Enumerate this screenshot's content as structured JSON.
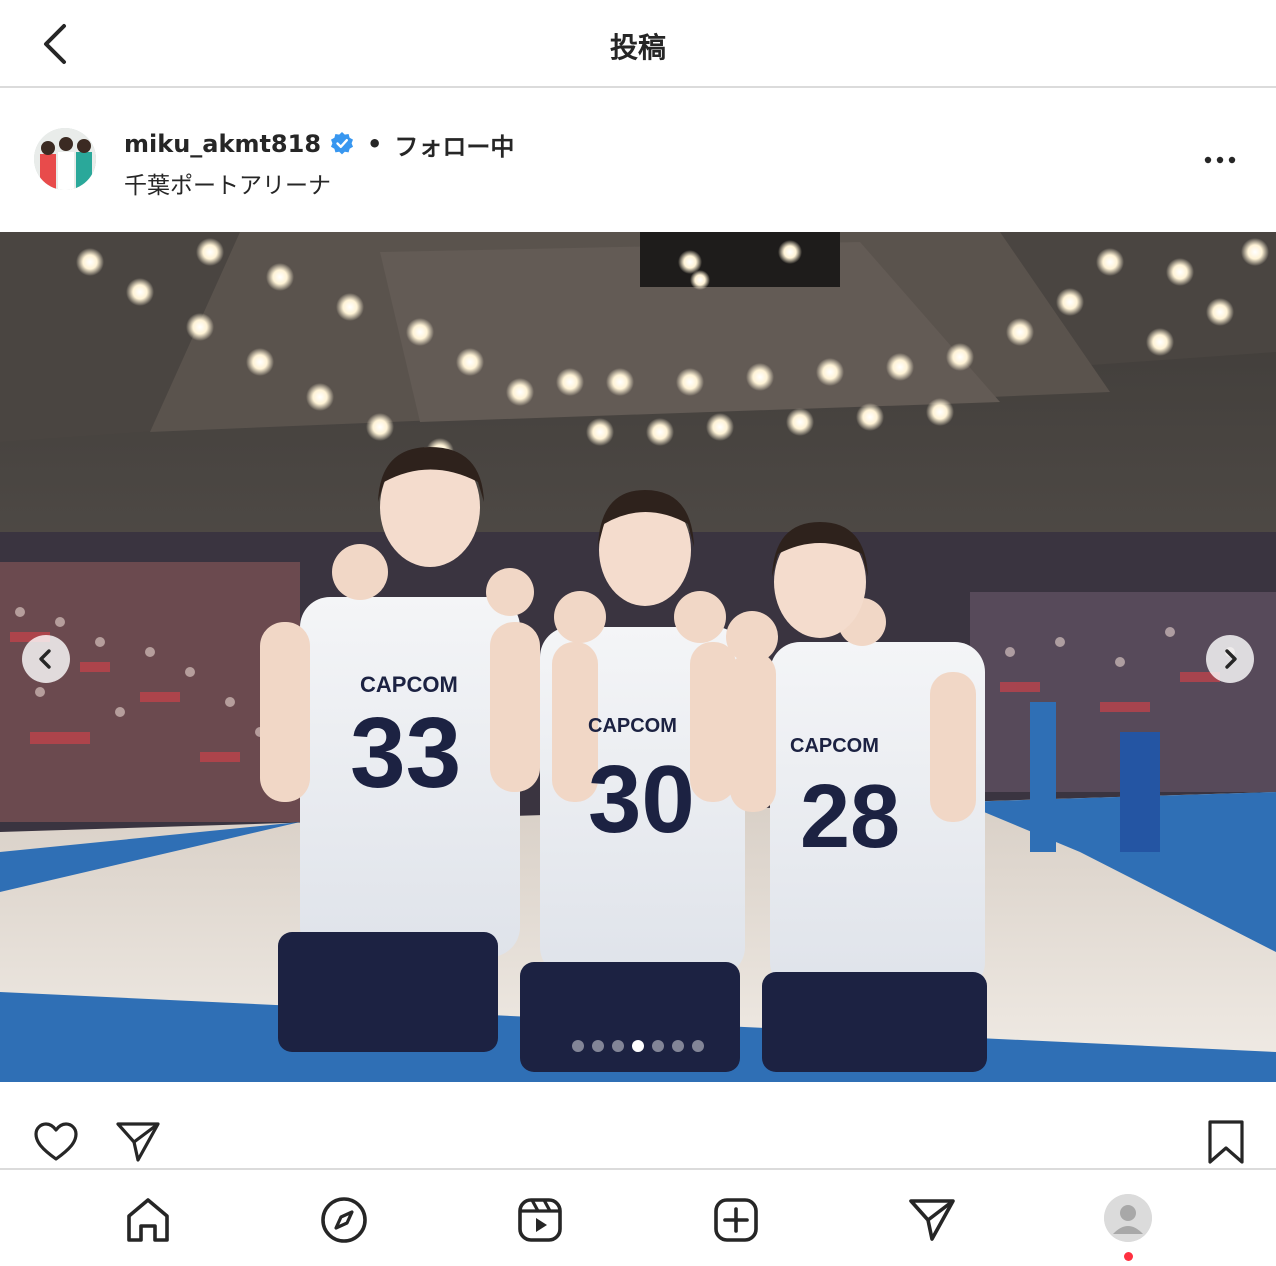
{
  "header": {
    "title": "投稿",
    "back_icon": "chevron-left-icon"
  },
  "post": {
    "username": "miku_akmt818",
    "verified": true,
    "separator": "•",
    "follow_status": "フォロー中",
    "location": "千葉ポートアリーナ",
    "more_icon": "ellipsis-icon"
  },
  "photo": {
    "jerseys": [
      {
        "brand": "CAPCOM",
        "number": "33"
      },
      {
        "brand": "CAPCOM",
        "number": "30"
      },
      {
        "brand": "CAPCOM",
        "number": "28"
      }
    ],
    "carousel": {
      "count": 7,
      "active_index": 3
    }
  },
  "actions": {
    "like_icon": "heart-icon",
    "share_icon": "paper-plane-icon",
    "save_icon": "bookmark-icon"
  },
  "nav": {
    "items": [
      "home-icon",
      "explore-icon",
      "reels-icon",
      "create-icon",
      "direct-icon",
      "profile-icon"
    ],
    "accent": "#ff3040"
  }
}
